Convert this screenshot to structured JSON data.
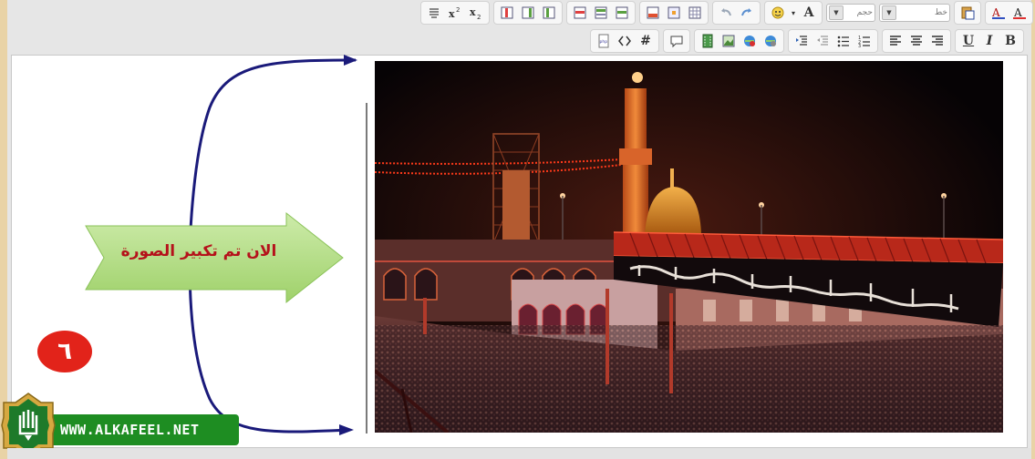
{
  "toolbar": {
    "font_combo_label": "خط",
    "size_combo_label": "حجم"
  },
  "annotation": {
    "label": "الان تم تكبير الصورة",
    "step_number": "٦"
  },
  "watermark": {
    "url_text": "WWW.ALKAFEEL.NET"
  },
  "colors": {
    "arrow_fill": "#b8df86",
    "label_text": "#b5121b",
    "curve_stroke": "#1a1a7a",
    "badge": "#e2231a",
    "logo_green": "#1e8d22",
    "frame_border": "#e9d3a6"
  }
}
